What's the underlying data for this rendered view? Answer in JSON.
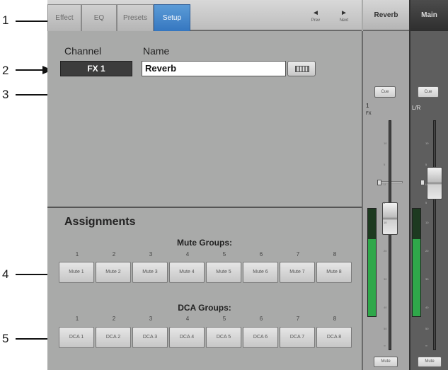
{
  "callouts": [
    "1",
    "2",
    "3",
    "4",
    "5"
  ],
  "tabs": [
    "Effect",
    "EQ",
    "Presets",
    "Setup"
  ],
  "active_tab": "Setup",
  "nav": {
    "prev_arrow": "◄",
    "prev_label": "Prev",
    "next_arrow": "►",
    "next_label": "Next"
  },
  "channel": {
    "label": "Channel",
    "value": "FX 1"
  },
  "name": {
    "label": "Name",
    "value": "Reverb"
  },
  "keyboard_icon": "keyboard-icon",
  "assignments": {
    "title": "Assignments",
    "mute_groups": {
      "title": "Mute Groups:",
      "numbers": [
        "1",
        "2",
        "3",
        "4",
        "5",
        "6",
        "7",
        "8"
      ],
      "buttons": [
        "Mute 1",
        "Mute 2",
        "Mute 3",
        "Mute 4",
        "Mute 5",
        "Mute 6",
        "Mute 7",
        "Mute 8"
      ]
    },
    "dca_groups": {
      "title": "DCA Groups:",
      "numbers": [
        "1",
        "2",
        "3",
        "4",
        "5",
        "6",
        "7",
        "8"
      ],
      "buttons": [
        "DCA 1",
        "DCA 2",
        "DCA 3",
        "DCA 4",
        "DCA 5",
        "DCA 6",
        "DCA 7",
        "DCA 8"
      ]
    }
  },
  "fx_strip": {
    "header": "Reverb",
    "cue": "Cue",
    "channel_num": "1",
    "channel_type": "FX",
    "mute": "Mute",
    "fader_ticks": [
      "10",
      "5",
      "U",
      "5",
      "10",
      "20",
      "30",
      "40",
      "50",
      "∞"
    ],
    "meter_level": 0.72
  },
  "main_strip": {
    "header": "Main",
    "cue": "Cue",
    "channel_label": "L/R",
    "mute": "Mute",
    "fader_ticks": [
      "10",
      "5",
      "U",
      "5",
      "10",
      "20",
      "30",
      "40",
      "50",
      "∞"
    ],
    "meter_level": 0.72
  },
  "colors": {
    "accent": "#3a7bc8",
    "meter_green": "#2fa84a",
    "panel_bg": "#a9aaa9"
  }
}
